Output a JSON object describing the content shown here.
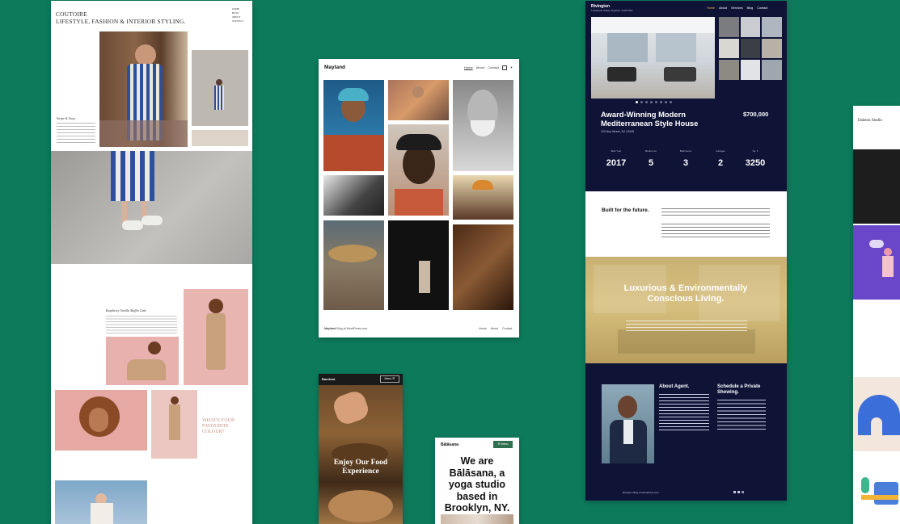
{
  "coutoire": {
    "brand_line1": "COUTOIRE",
    "brand_line2": "LIFESTYLE, FASHION & INTERIOR STYLING.",
    "nav": [
      "HOME",
      "BLOG",
      "ABOUT",
      "CONTACT"
    ],
    "caption_top": "Stripe & Sway",
    "caption_mid": "Raspberry Vanilla Muffin Cake",
    "favourite": "WHAT'S YOUR FAVOURITE COLOUR?"
  },
  "mayland": {
    "brand": "Mayland",
    "nav": [
      "Home",
      "About",
      "Contact"
    ],
    "footer_brand": "Mayland",
    "footer_blog": "Blog at WordPress.com.",
    "footer_nav": [
      "Home",
      "About",
      "Contact"
    ]
  },
  "rivington": {
    "brand": "Rivington",
    "address": "1 Example Street, Anytown, 4100 USA",
    "nav": [
      "Home",
      "About",
      "Services",
      "Blog",
      "Contact"
    ],
    "title": "Award-Winning Modern Mediterranean Style House",
    "street": "123 Any Street, NJ 12345",
    "price": "$700,000",
    "stats": [
      {
        "label": "Built Year",
        "value": "2017"
      },
      {
        "label": "Bedrooms",
        "value": "5"
      },
      {
        "label": "Bathrooms",
        "value": "3"
      },
      {
        "label": "Garages",
        "value": "2"
      },
      {
        "label": "Sq. ft",
        "value": "3250"
      }
    ],
    "built_heading": "Built for the future.",
    "luxury": "Luxurious & Environmentally Conscious Living.",
    "about_agent": "About Agent.",
    "schedule": "Schedule a Private Showing.",
    "footer": "Rivington  Blog at WordPress.com."
  },
  "dalston": {
    "brand": "Dalston Studio"
  },
  "food": {
    "brand": "Barefoot",
    "menu": "Menu",
    "headline": "Enjoy Our Food Experience"
  },
  "balasana": {
    "brand": "Bālāsana",
    "menu": "Menu",
    "headline": "We are Bālāsana, a yoga studio based in Brooklyn, NY."
  }
}
